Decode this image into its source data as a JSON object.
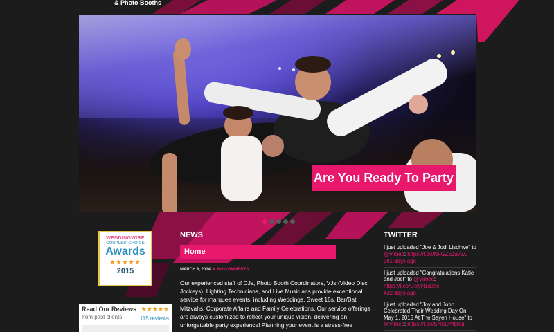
{
  "header": {
    "logo_text": "& Photo Booths"
  },
  "hero": {
    "caption": "Are You Ready To Party",
    "slide_count": 5,
    "active_slide": 0
  },
  "sidebar": {
    "badge": {
      "brand": "WEDDINGWIRE",
      "subtitle": "COUPLES' CHOICE",
      "title": "Awards",
      "stars": "★★★★★",
      "year": "2015"
    },
    "reviews": {
      "title": "Read Our Reviews",
      "stars": "★★★★★",
      "from": "from past clients",
      "count": "115 reviews"
    }
  },
  "news": {
    "heading": "NEWS",
    "tab": "Home",
    "date": "MARCH 8, 2014",
    "comments": "NO COMMENTS",
    "body": "Our experienced staff of DJs, Photo Booth Coordinators, VJs (Video Disc Jockeys), Lighting Technicians, and Live Musicians provide exceptional service for marquee events, including Weddings, Sweet 16s, Bar/Bat Mitzvahs, Corporate Affairs and Family Celebrations. Our service offerings are always customized to reflect your unique vision, delivering an unforgettable party experience! Planning your event is a stress-free"
  },
  "twitter": {
    "heading": "TWITTER",
    "tweets": [
      {
        "text": "I just uploaded \"Joe & Jodi Lischwe\" to ",
        "mention": "@Vimeo",
        "text2": ": ",
        "link": "https://t.co/NFGZEza7w0",
        "age": "381 days ago"
      },
      {
        "text": "I just uploaded \"Congratulations Katie and Joel\" to ",
        "mention": "@Vimeo",
        "text2": ": ",
        "link": "https://t.co/GclyH1dJac",
        "age": "432 days ago"
      },
      {
        "text": "I just uploaded \"Joy and John Celebrated Their Wedding Day On May 1, 2015 At The Sayen House\" to ",
        "mention": "@Vimeo",
        "text2": ": ",
        "link": "https://t.co/SNSCAfbfeg",
        "age": ""
      }
    ]
  },
  "colors": {
    "accent": "#e8186d",
    "background": "#1c1c1c"
  }
}
